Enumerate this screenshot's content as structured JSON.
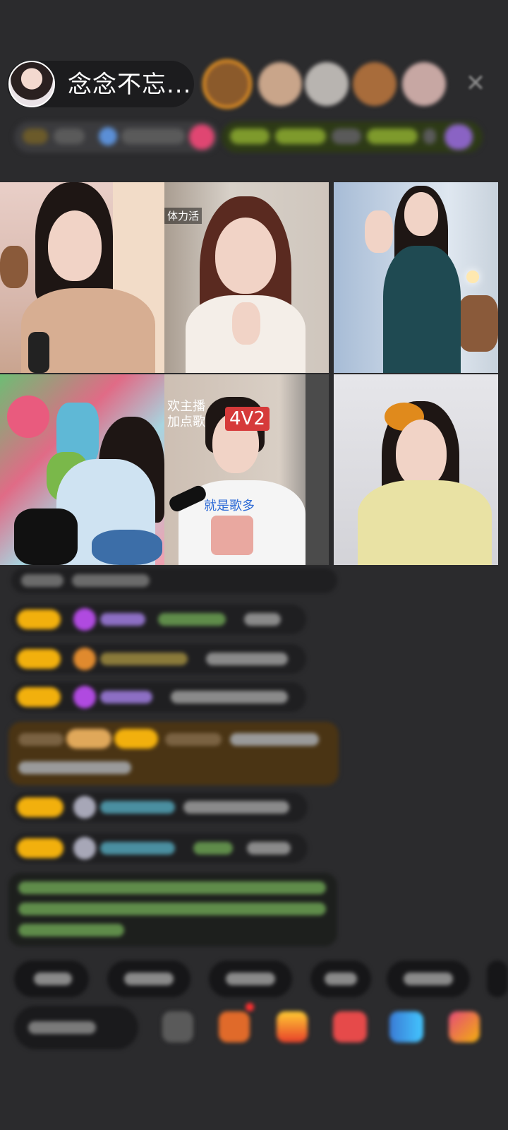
{
  "header": {
    "host_name": "念念不忘...",
    "viewers": [
      {
        "color": "#8b5a2b"
      },
      {
        "color": "#c9a58a"
      },
      {
        "color": "#b8b4b0"
      },
      {
        "color": "#a86c3b"
      },
      {
        "color": "#c7a7a3"
      }
    ]
  },
  "video_grid": {
    "cells": [
      {
        "id": "tile-1",
        "overlay": ""
      },
      {
        "id": "tile-2",
        "overlay": "体力活"
      },
      {
        "id": "tile-3",
        "overlay": ""
      },
      {
        "id": "tile-4",
        "overlay": ""
      },
      {
        "id": "tile-5",
        "overlay": "欢主播",
        "overlay2": "加点歌",
        "pk_badge": "4V2",
        "caption": "就是歌多"
      },
      {
        "id": "tile-6",
        "overlay": ""
      }
    ]
  },
  "colors": {
    "background": "#2b2b2d",
    "level_badge": "#f2b00d",
    "chat_bubble": "#1f1f21",
    "highlight_bubble": "#4a3414",
    "viewer_ring": "#f39a22"
  }
}
